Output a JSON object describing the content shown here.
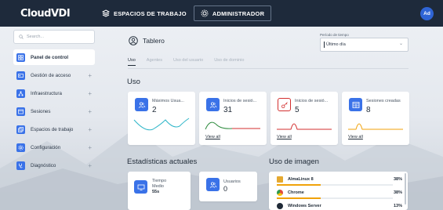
{
  "topbar": {
    "logo": "CloudVDI",
    "nav": [
      {
        "label": "ESPACIOS DE TRABAJO",
        "icon": "layers-icon"
      },
      {
        "label": "ADMINISTRADOR",
        "icon": "gear-icon"
      }
    ],
    "avatar_initials": "Ad"
  },
  "sidebar": {
    "search_placeholder": "Search...",
    "items": [
      {
        "label": "Panel de control",
        "icon": "dashboard-icon",
        "expandable": false,
        "active": true
      },
      {
        "label": "Gestión de acceso",
        "icon": "id-card-icon",
        "expandable": true
      },
      {
        "label": "Infraestructura",
        "icon": "network-icon",
        "expandable": true
      },
      {
        "label": "Sesiones",
        "icon": "sessions-icon",
        "expandable": true
      },
      {
        "label": "Espacios de trabajo",
        "icon": "workspace-icon",
        "expandable": true
      },
      {
        "label": "Configuración",
        "icon": "gear-icon",
        "expandable": true
      },
      {
        "label": "Diagnóstico",
        "icon": "stethoscope-icon",
        "expandable": true
      }
    ],
    "plus": "+"
  },
  "main": {
    "title": "Tablero",
    "period_label": "Período de tiempo",
    "period_value": "Último día",
    "tabs": [
      "Uso",
      "Agentes",
      "Uso del usuario",
      "Uso de dominio"
    ],
    "uso_title": "Uso",
    "stats": [
      {
        "label": "Máximos Usua...",
        "value": "2",
        "color": "#3a72e8",
        "spark": "#2fb6c9",
        "icon": "users-icon"
      },
      {
        "label": "Inicios de sesió...",
        "value": "31",
        "color": "#3a72e8",
        "spark": "#2e8b3e",
        "icon": "users-icon",
        "view_all": "View all"
      },
      {
        "label": "Inicios de sesió...",
        "value": "5",
        "color": "#3a72e8",
        "spark": "#d32f2f",
        "icon": "key-icon",
        "view_all": "View all"
      },
      {
        "label": "Sesiones creadas",
        "value": "8",
        "color": "#3a72e8",
        "spark": "#f0a20a",
        "icon": "window-icon",
        "view_all": "View all"
      }
    ],
    "actuales_title": "Estadísticas actuales",
    "actuales": [
      {
        "label1": "Tiempo",
        "label2": "Medio",
        "value": "55s",
        "icon": "monitor-icon"
      },
      {
        "label1": "Usuarios",
        "value": "0",
        "icon": "users-icon"
      }
    ],
    "imagen_title": "Uso de imagen",
    "imagenes": [
      {
        "name": "AlmaLinux 8",
        "percent": "38%",
        "fill": 0.38,
        "icon_color": "#e5a930"
      },
      {
        "name": "Chrome",
        "percent": "38%",
        "fill": 0.38,
        "icon_color": "#e24a3b"
      },
      {
        "name": "Windows Server",
        "percent": "13%",
        "fill": 0.13,
        "icon_color": "#1f2a37"
      }
    ]
  }
}
